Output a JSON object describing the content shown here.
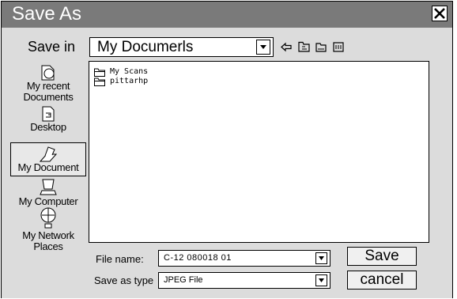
{
  "window": {
    "title": "Save As"
  },
  "toolbar": {
    "save_in_label": "Save in",
    "save_in_value": "My Documerls",
    "icons": [
      "back-arrow-icon",
      "up-folder-icon",
      "new-folder-icon",
      "view-menu-icon"
    ]
  },
  "places": [
    {
      "label": "My recent\nDocuments",
      "icon": "recent-documents-icon"
    },
    {
      "label": "Desktop",
      "icon": "desktop-icon"
    },
    {
      "label": "My Document",
      "icon": "my-documents-icon",
      "selected": true
    },
    {
      "label": "My Computer",
      "icon": "computer-icon"
    },
    {
      "label": "My Network\nPlaces",
      "icon": "network-places-icon"
    }
  ],
  "files": [
    {
      "name": "My Scans",
      "icon": "folder-icon"
    },
    {
      "name": "pittarhp",
      "icon": "folder-icon"
    }
  ],
  "form": {
    "file_name_label": "File name:",
    "file_name_value": "C-12 080018 01",
    "save_type_label": "Save as type",
    "save_type_value": "JPEG File"
  },
  "buttons": {
    "save": "Save",
    "cancel": "cancel"
  }
}
